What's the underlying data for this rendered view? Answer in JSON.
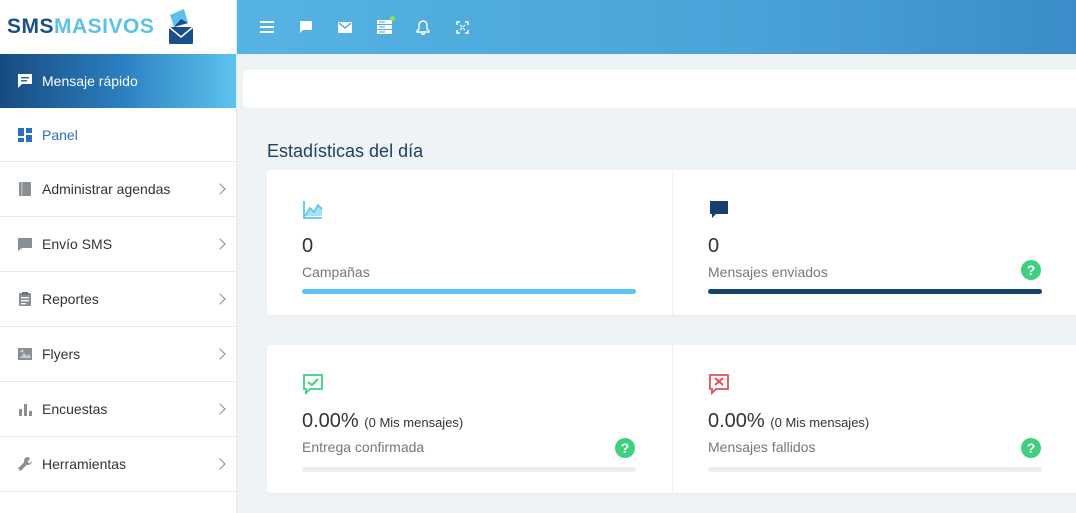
{
  "logo": {
    "part1": "SMS",
    "part2": "MASIVOS"
  },
  "sidebar": {
    "quick_message": "Mensaje rápido",
    "items": [
      {
        "label": "Panel",
        "icon": "dashboard-icon"
      },
      {
        "label": "Administrar agendas",
        "icon": "book-icon"
      },
      {
        "label": "Envío SMS",
        "icon": "chat-icon"
      },
      {
        "label": "Reportes",
        "icon": "clipboard-icon"
      },
      {
        "label": "Flyers",
        "icon": "image-icon"
      },
      {
        "label": "Encuestas",
        "icon": "bar-chart-icon"
      },
      {
        "label": "Herramientas",
        "icon": "wrench-icon"
      }
    ]
  },
  "topbar": {
    "icons": [
      "menu-icon",
      "chat-icon",
      "mail-icon",
      "server-icon",
      "bell-icon",
      "fullscreen-icon"
    ]
  },
  "main": {
    "title": "Estadísticas del día",
    "stats": [
      {
        "value": "0",
        "sub": "",
        "label": "Campañas",
        "progress": 1.0,
        "color": "#5bc6ef"
      },
      {
        "value": "0",
        "sub": "",
        "label": "Mensajes enviados",
        "progress": 1.0,
        "color": "#17406e"
      },
      {
        "value": "0.00%",
        "sub": "(0 Mis mensajes)",
        "label": "Entrega confirmada",
        "progress": 0.0,
        "color": "#3fcf7e"
      },
      {
        "value": "0.00%",
        "sub": "(0 Mis mensajes)",
        "label": "Mensajes fallidos",
        "progress": 0.0,
        "color": "#e0505a"
      }
    ],
    "help_glyph": "?"
  },
  "colors": {
    "accent": "#2b6fbd",
    "brand_dark": "#1a4f8a",
    "brand_light": "#5cc1ea",
    "success": "#3fcf7e",
    "danger": "#e0505a"
  }
}
